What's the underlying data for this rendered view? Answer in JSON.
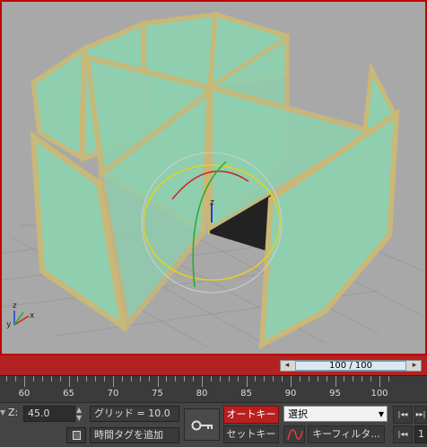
{
  "viewport": {
    "axis_labels": {
      "x": "x",
      "y": "y",
      "z": "z"
    },
    "gizmo_label": "z",
    "colors": {
      "border": "#c00000",
      "background": "#a8a8a8",
      "glass": "#8fcfaf",
      "frame": "#c9b877"
    }
  },
  "timeslider": {
    "position_text": "100 / 100",
    "prev_icon": "◂",
    "next_icon": "▸",
    "current_frame": 100,
    "total_frames": 100
  },
  "ruler": {
    "labels": [
      "60",
      "65",
      "70",
      "75",
      "80",
      "85",
      "90",
      "95",
      "100"
    ]
  },
  "status": {
    "z_label": "Z:",
    "z_value": "45.0",
    "grid_text": "グリッド = 10.0",
    "add_time_tag": "時間タグを追加",
    "auto_key": "オートキー",
    "set_key": "セットキー",
    "selection_value": "選択",
    "key_filter": "キーフィルタ...",
    "spinner_up": "▲",
    "spinner_down": "▼",
    "dropdown_arrow": "▼",
    "playback_start": "|◂◂",
    "playback_end": "▸▸|",
    "frame_field": "1"
  },
  "icons": {
    "key": "key-icon",
    "curve": "curve-editor-icon",
    "lock": "selection-lock-icon",
    "goto_start": "goto-start-icon",
    "goto_end": "goto-end-icon"
  }
}
